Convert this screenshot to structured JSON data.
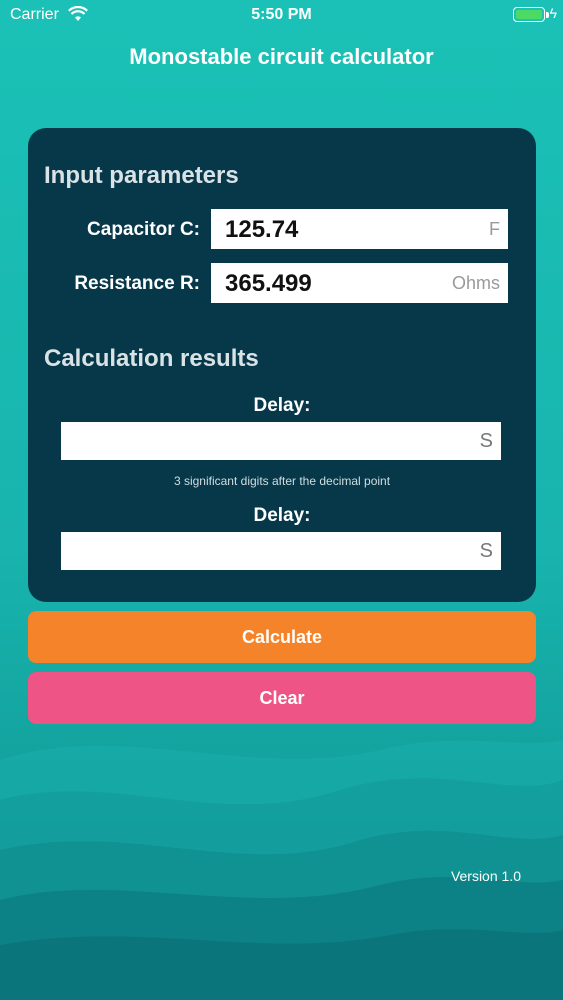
{
  "status_bar": {
    "carrier": "Carrier",
    "time": "5:50 PM"
  },
  "app": {
    "title": "Monostable circuit calculator",
    "version": "Version 1.0"
  },
  "input_section": {
    "title": "Input parameters",
    "capacitor": {
      "label": "Capacitor C:",
      "value": "125.74",
      "unit": "F"
    },
    "resistance": {
      "label": "Resistance R:",
      "value": "365.499",
      "unit": "Ohms"
    }
  },
  "results_section": {
    "title": "Calculation results",
    "delay1": {
      "label": "Delay:",
      "value": "",
      "unit": "S"
    },
    "hint": "3 significant digits after the decimal point",
    "delay2": {
      "label": "Delay:",
      "value": "",
      "unit": "S"
    }
  },
  "buttons": {
    "calculate": "Calculate",
    "clear": "Clear"
  },
  "colors": {
    "card": "#07384a",
    "calculate": "#f5832a",
    "clear": "#ee5486",
    "background": "#1bc1b6"
  }
}
